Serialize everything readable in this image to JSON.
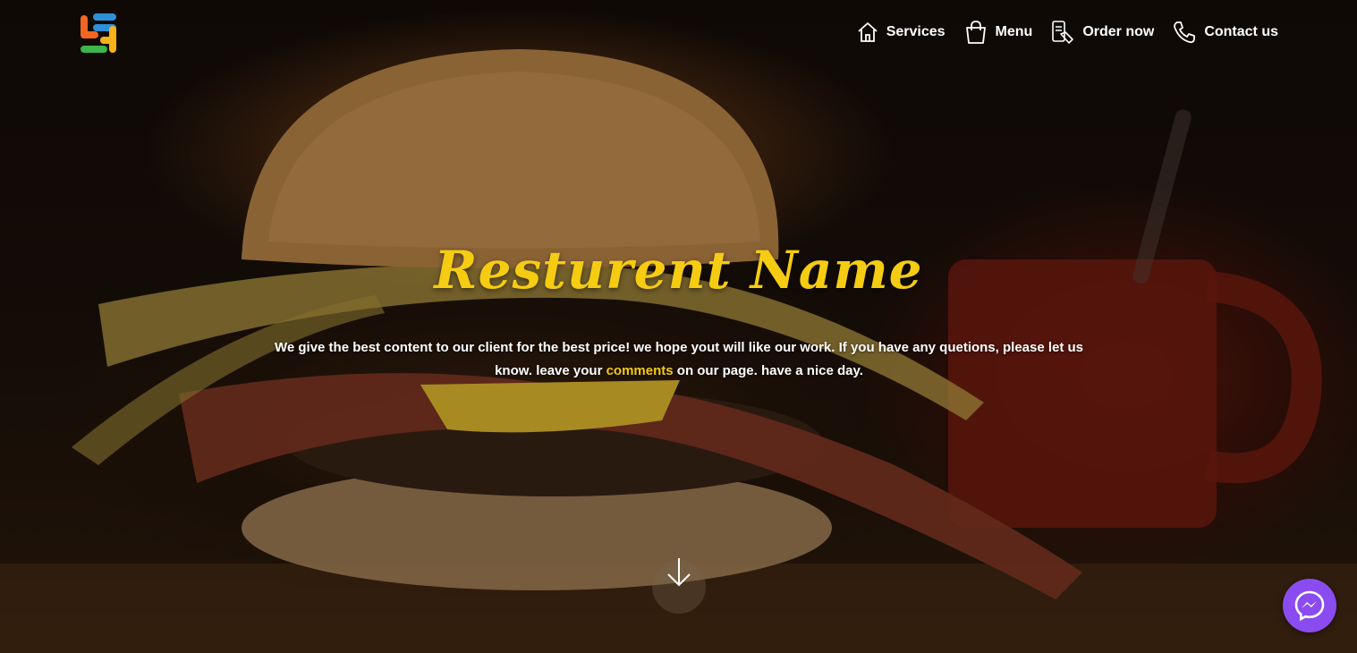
{
  "nav": {
    "items": [
      {
        "label": "Services",
        "icon": "home-icon"
      },
      {
        "label": "Menu",
        "icon": "shopping-bag-icon"
      },
      {
        "label": "Order now",
        "icon": "phone-order-icon"
      },
      {
        "label": "Contact us",
        "icon": "phone-icon"
      }
    ]
  },
  "hero": {
    "title": "Resturent Name",
    "tagline_before": "We give the best content to our client for the best price! we hope yout will like our work. If you have any quetions, please let us know. leave your ",
    "tagline_highlight": "comments",
    "tagline_after": " on our page. have a nice day."
  },
  "colors": {
    "accent": "#f5cc12",
    "messenger": "#8a4cf0"
  }
}
